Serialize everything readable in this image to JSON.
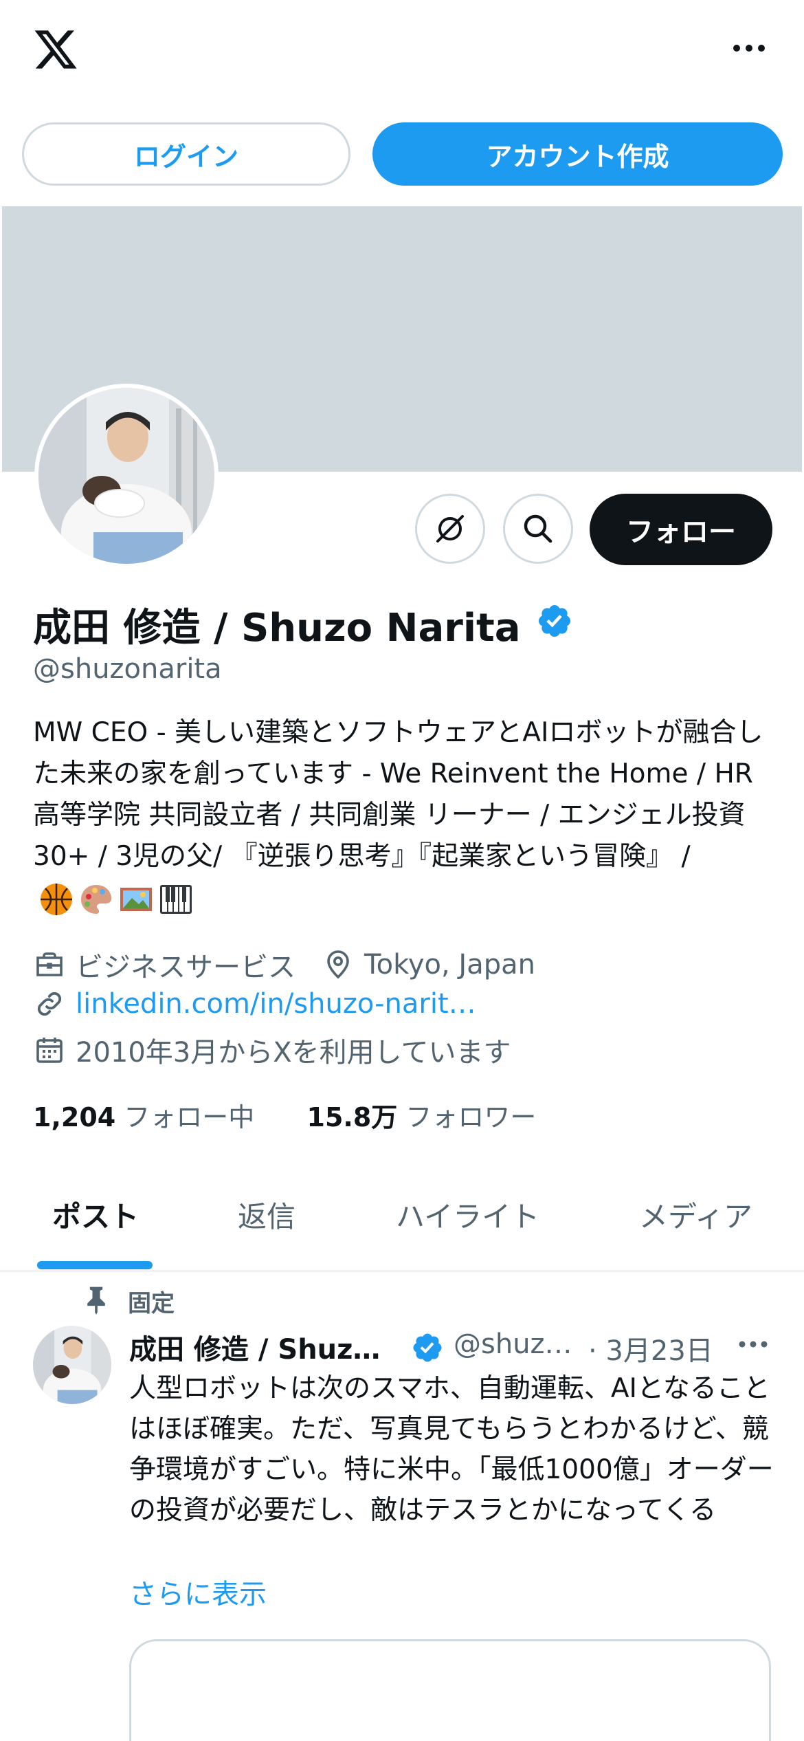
{
  "topbar": {
    "logo_icon": "x-logo-icon",
    "more_icon": "more-horizontal-icon"
  },
  "auth": {
    "login_label": "ログイン",
    "signup_label": "アカウント作成"
  },
  "profile": {
    "display_name": "成田 修造 / Shuzo Narita",
    "handle": "@shuzonarita",
    "bio": "MW CEO - 美しい建築とソフトウェアとAIロボットが融合した未来の家を創っています - We Reinvent the Home / HR高等学院 共同設立者 / 共同創業 リーナー / エンジェル投資30+ / 3児の父/ 『逆張り思考』『起業家という冒険』 /",
    "category": "ビジネスサービス",
    "location": "Tokyo, Japan",
    "website": "linkedin.com/in/shuzo-narit…",
    "joined": "2010年3月からXを利用しています",
    "following_count": "1,204",
    "following_label": "フォロー中",
    "followers_count": "15.8万",
    "followers_label": "フォロワー",
    "follow_label": "フォロー",
    "colors": {
      "accent": "#1d9bf0",
      "dark": "#0f1419",
      "muted": "#536471",
      "banner": "#cfd9de"
    }
  },
  "tabs": [
    {
      "label": "ポスト",
      "active": true
    },
    {
      "label": "返信",
      "active": false
    },
    {
      "label": "ハイライト",
      "active": false
    },
    {
      "label": "メディア",
      "active": false
    }
  ],
  "post": {
    "pinned_label": "固定",
    "author_name": "成田 修造 / Shuz…",
    "author_handle": "@shuz…",
    "date": "· 3月23日",
    "text": "人型ロボットは次のスマホ、自動運転、AIとなることはほぼ確実。ただ、写真見てもらうとわかるけど、競争環境がすごい。特に米中。「最低1000億」オーダーの投資が必要だし、敵はテスラとかになってくる",
    "show_more": "さらに表示"
  }
}
